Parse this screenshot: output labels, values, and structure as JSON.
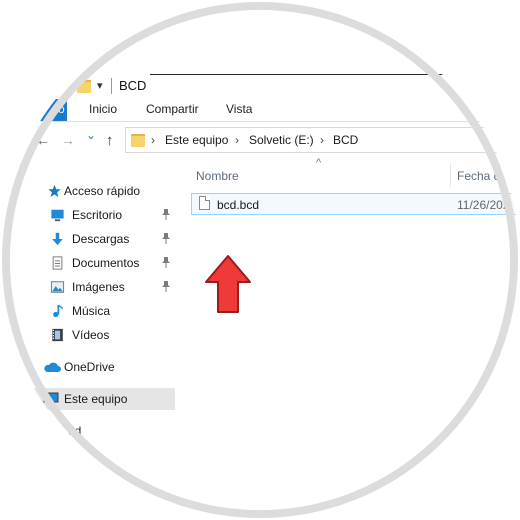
{
  "window": {
    "title": "BCD",
    "quick_access_arrow": "▾"
  },
  "ribbon": {
    "file_tab": "o",
    "tabs": [
      "Inicio",
      "Compartir",
      "Vista"
    ]
  },
  "address": {
    "back_arrow": "←",
    "forward_arrow": "→",
    "recent_arrow": "⌄",
    "up_arrow": "↑",
    "separator": "›",
    "crumbs": [
      "Este equipo",
      "Solvetic (E:)",
      "BCD"
    ]
  },
  "sidebar": {
    "quick_access": "Acceso rápido",
    "items": [
      {
        "label": "Escritorio",
        "icon": "desktop-icon",
        "pinned": true
      },
      {
        "label": "Descargas",
        "icon": "download-icon",
        "pinned": true
      },
      {
        "label": "Documentos",
        "icon": "document-icon",
        "pinned": true
      },
      {
        "label": "Imágenes",
        "icon": "pictures-icon",
        "pinned": true
      },
      {
        "label": "Música",
        "icon": "music-icon",
        "pinned": false
      },
      {
        "label": "Vídeos",
        "icon": "video-icon",
        "pinned": false
      }
    ],
    "onedrive": "OneDrive",
    "this_pc": "Este equipo",
    "network_partial": "ed",
    "pin_glyph": "📌"
  },
  "content": {
    "sort_indicator": "^",
    "columns": {
      "name": "Nombre",
      "date": "Fecha d"
    },
    "files": [
      {
        "name": "bcd.bcd",
        "date": "11/26/202"
      }
    ]
  },
  "colors": {
    "accent": "#1979ca",
    "selection_border": "#99d1ff",
    "red_arrow": "#f03a3a"
  }
}
